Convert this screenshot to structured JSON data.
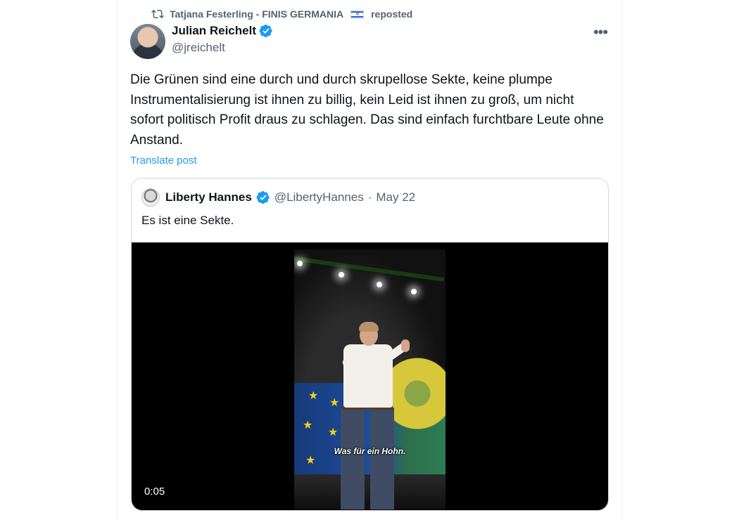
{
  "repost": {
    "reposter": "Tatjana Festerling - FINIS GERMANIA",
    "suffix": "reposted"
  },
  "post": {
    "author_name": "Julian Reichelt",
    "author_handle": "@jreichelt",
    "text": "Die Grünen sind eine durch und durch skrupellose Sekte, keine plumpe Instrumentalisierung ist ihnen zu billig, kein Leid ist ihnen zu groß, um nicht sofort politisch Profit draus zu schlagen. Das sind einfach furchtbare Leute ohne Anstand.",
    "translate_label": "Translate post"
  },
  "quote": {
    "author_name": "Liberty Hannes",
    "author_handle": "@LibertyHannes",
    "separator": "·",
    "date": "May 22",
    "text": "Es ist eine Sekte.",
    "video": {
      "subtitle": "Was für ein Hohn.",
      "timestamp": "0:05"
    }
  },
  "colors": {
    "accent": "#1d9bf0",
    "muted": "#536471",
    "border": "#cfd9de"
  },
  "icons": {
    "repost": "repost-icon",
    "verified": "verified-badge-icon",
    "more": "more-icon",
    "flag": "israel-flag-icon"
  }
}
